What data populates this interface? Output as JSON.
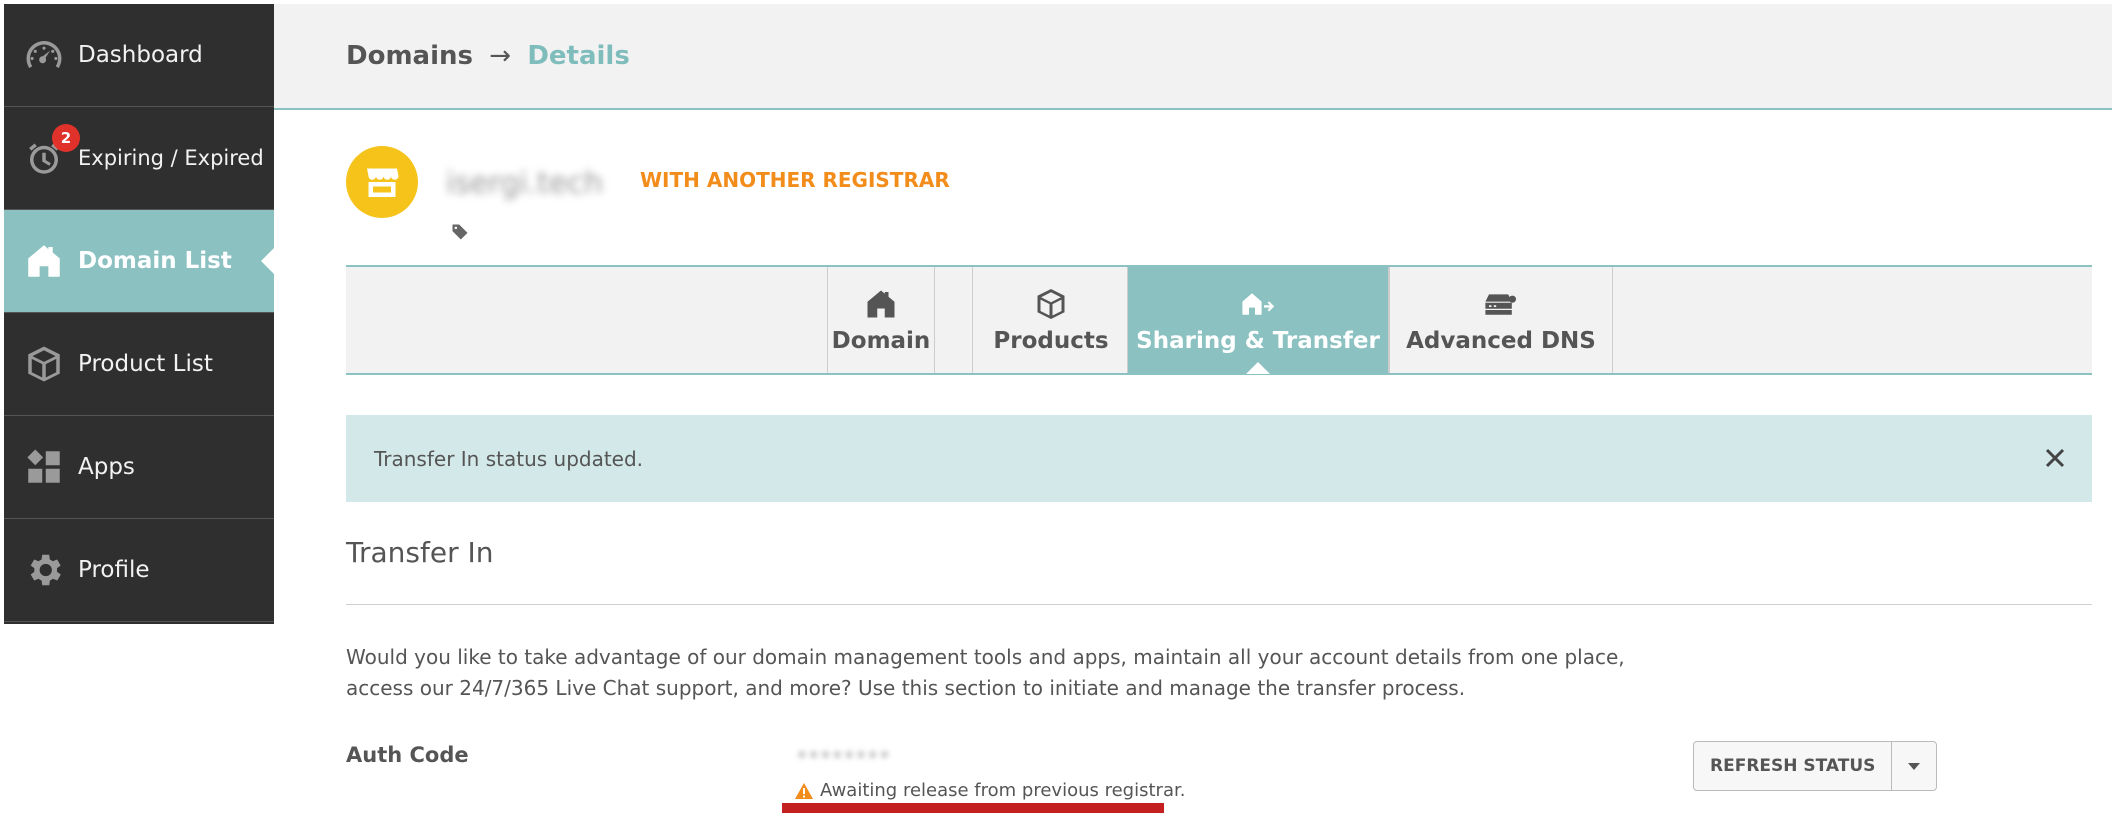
{
  "sidebar": {
    "items": [
      {
        "label": "Dashboard",
        "icon": "speedometer-icon"
      },
      {
        "label": "Expiring / Expired",
        "icon": "timer-icon",
        "badge": "2"
      },
      {
        "label": "Domain List",
        "icon": "house-icon",
        "active": true
      },
      {
        "label": "Product List",
        "icon": "box-icon"
      },
      {
        "label": "Apps",
        "icon": "apps-icon"
      },
      {
        "label": "Profile",
        "icon": "gear-icon"
      }
    ]
  },
  "breadcrumb": {
    "parent": "Domains",
    "separator": "→",
    "current": "Details"
  },
  "domain": {
    "name": "isergi.tech",
    "registrar_status": "WITH ANOTHER REGISTRAR"
  },
  "tabs": [
    {
      "label": "Domain",
      "icon": "house-icon"
    },
    {
      "label": "Products",
      "icon": "box-icon"
    },
    {
      "label": "Sharing & Transfer",
      "icon": "house-transfer-icon",
      "active": true
    },
    {
      "label": "Advanced DNS",
      "icon": "dns-server-icon"
    }
  ],
  "alert": {
    "message": "Transfer In status updated."
  },
  "transfer": {
    "title": "Transfer In",
    "intro": "Would you like to take advantage of our domain management tools and apps, maintain all your account details from one place, access our 24/7/365 Live Chat support, and more? Use this section to initiate and manage the transfer process.",
    "auth_label": "Auth Code",
    "auth_value": "••••••••",
    "status_text": "Awaiting release from previous registrar.",
    "refresh_label": "REFRESH STATUS"
  },
  "colors": {
    "accent": "#8bc1c1",
    "warning": "#f28c1a",
    "store_circle": "#f6c31a",
    "sidebar_bg": "#2f2f2f",
    "badge": "#e0322a"
  }
}
